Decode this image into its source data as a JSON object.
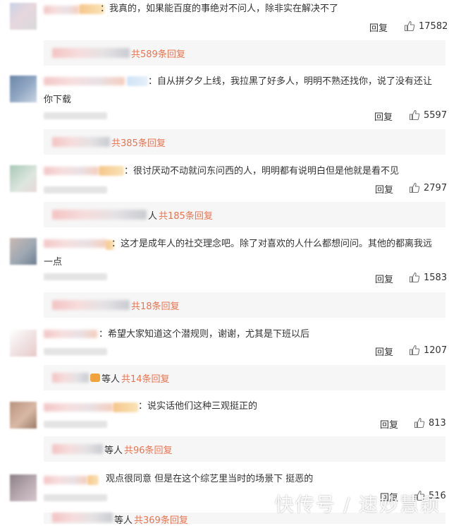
{
  "comments": [
    {
      "text": "：我真的，如果能百度的事绝对不问人，除非实在解决不了",
      "text2": "",
      "reply": "回复",
      "likes": "17582",
      "thread": "共589条回复",
      "thread_prefix": ""
    },
    {
      "text": "：自从拼夕夕上线，我拉黑了好多人，明明不熟还找你，说了没有还让",
      "text2": "你下载",
      "reply": "回复",
      "likes": "5597",
      "thread": "共385条回复",
      "thread_prefix": ""
    },
    {
      "text": "：很讨厌动不动就问东问西的人，明明都有说明白但是他就是看不见",
      "text2": "",
      "reply": "回复",
      "likes": "2797",
      "thread": "共185条回复",
      "thread_prefix": "人"
    },
    {
      "text": "：这才是成年人的社交理念吧。除了对喜欢的人什么都想问问。其他的都离我远",
      "text2": "一点",
      "reply": "回复",
      "likes": "1583",
      "thread": "共18条回复",
      "thread_prefix": ""
    },
    {
      "text": "：希望大家知道这个潜规则，谢谢，尤其是下班以后",
      "text2": "",
      "reply": "回复",
      "likes": "1207",
      "thread": "共14条回复",
      "thread_prefix": "等人"
    },
    {
      "text": "：说实话他们这种三观挺正的",
      "text2": "",
      "reply": "回复",
      "likes": "813",
      "thread": "共96条回复",
      "thread_prefix": "等人"
    },
    {
      "text": "观点很同意 但是在这个综艺里当时的场景下 挺恶的",
      "text2": "",
      "reply": "回复",
      "likes": "516",
      "thread": "共369条回复",
      "thread_prefix": "等人"
    }
  ],
  "watermark": "快传号 / 速妙慧颖",
  "colors": {
    "accent": "#eb7350",
    "thread_bg": "#f6f6f6",
    "text": "#333333"
  }
}
